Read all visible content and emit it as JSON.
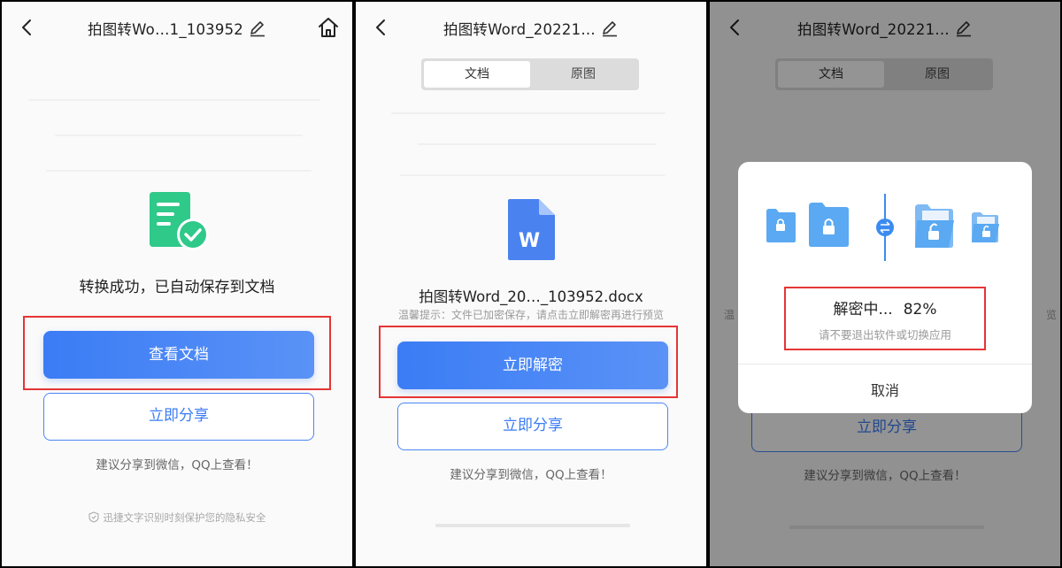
{
  "screen1": {
    "title": "拍图转Wo…1_103952",
    "message": "转换成功，已自动保存到文档",
    "primary_button": "查看文档",
    "share_button": "立即分享",
    "suggestion": "建议分享到微信，QQ上查看！",
    "privacy_note": "迅捷文字识别时刻保护您的隐私安全"
  },
  "screen2": {
    "title": "拍图转Word_20221…",
    "tabs": [
      "文档",
      "原图"
    ],
    "active_tab": "文档",
    "file_icon_letter": "W",
    "filename": "拍图转Word_20…_103952.docx",
    "hint": "温馨提示：文件已加密保存，请点击立即解密再进行预览",
    "primary_button": "立即解密",
    "share_button": "立即分享",
    "suggestion": "建议分享到微信，QQ上查看！"
  },
  "screen3": {
    "title": "拍图转Word_20221…",
    "tabs": [
      "文档",
      "原图"
    ],
    "active_tab": "文档",
    "share_button": "立即分享",
    "suggestion": "建议分享到微信，QQ上查看！",
    "hint_left_fragment": "温",
    "hint_right_fragment": "览",
    "dialog": {
      "status": "解密中...",
      "percent": "82%",
      "progress": 0.82,
      "warning": "请不要退出软件或切换应用",
      "cancel": "取消"
    }
  },
  "colors": {
    "accent": "#3b7cf5",
    "success": "#2fc98a",
    "highlight_box": "#e53535",
    "folder": "#5aa9f2"
  }
}
